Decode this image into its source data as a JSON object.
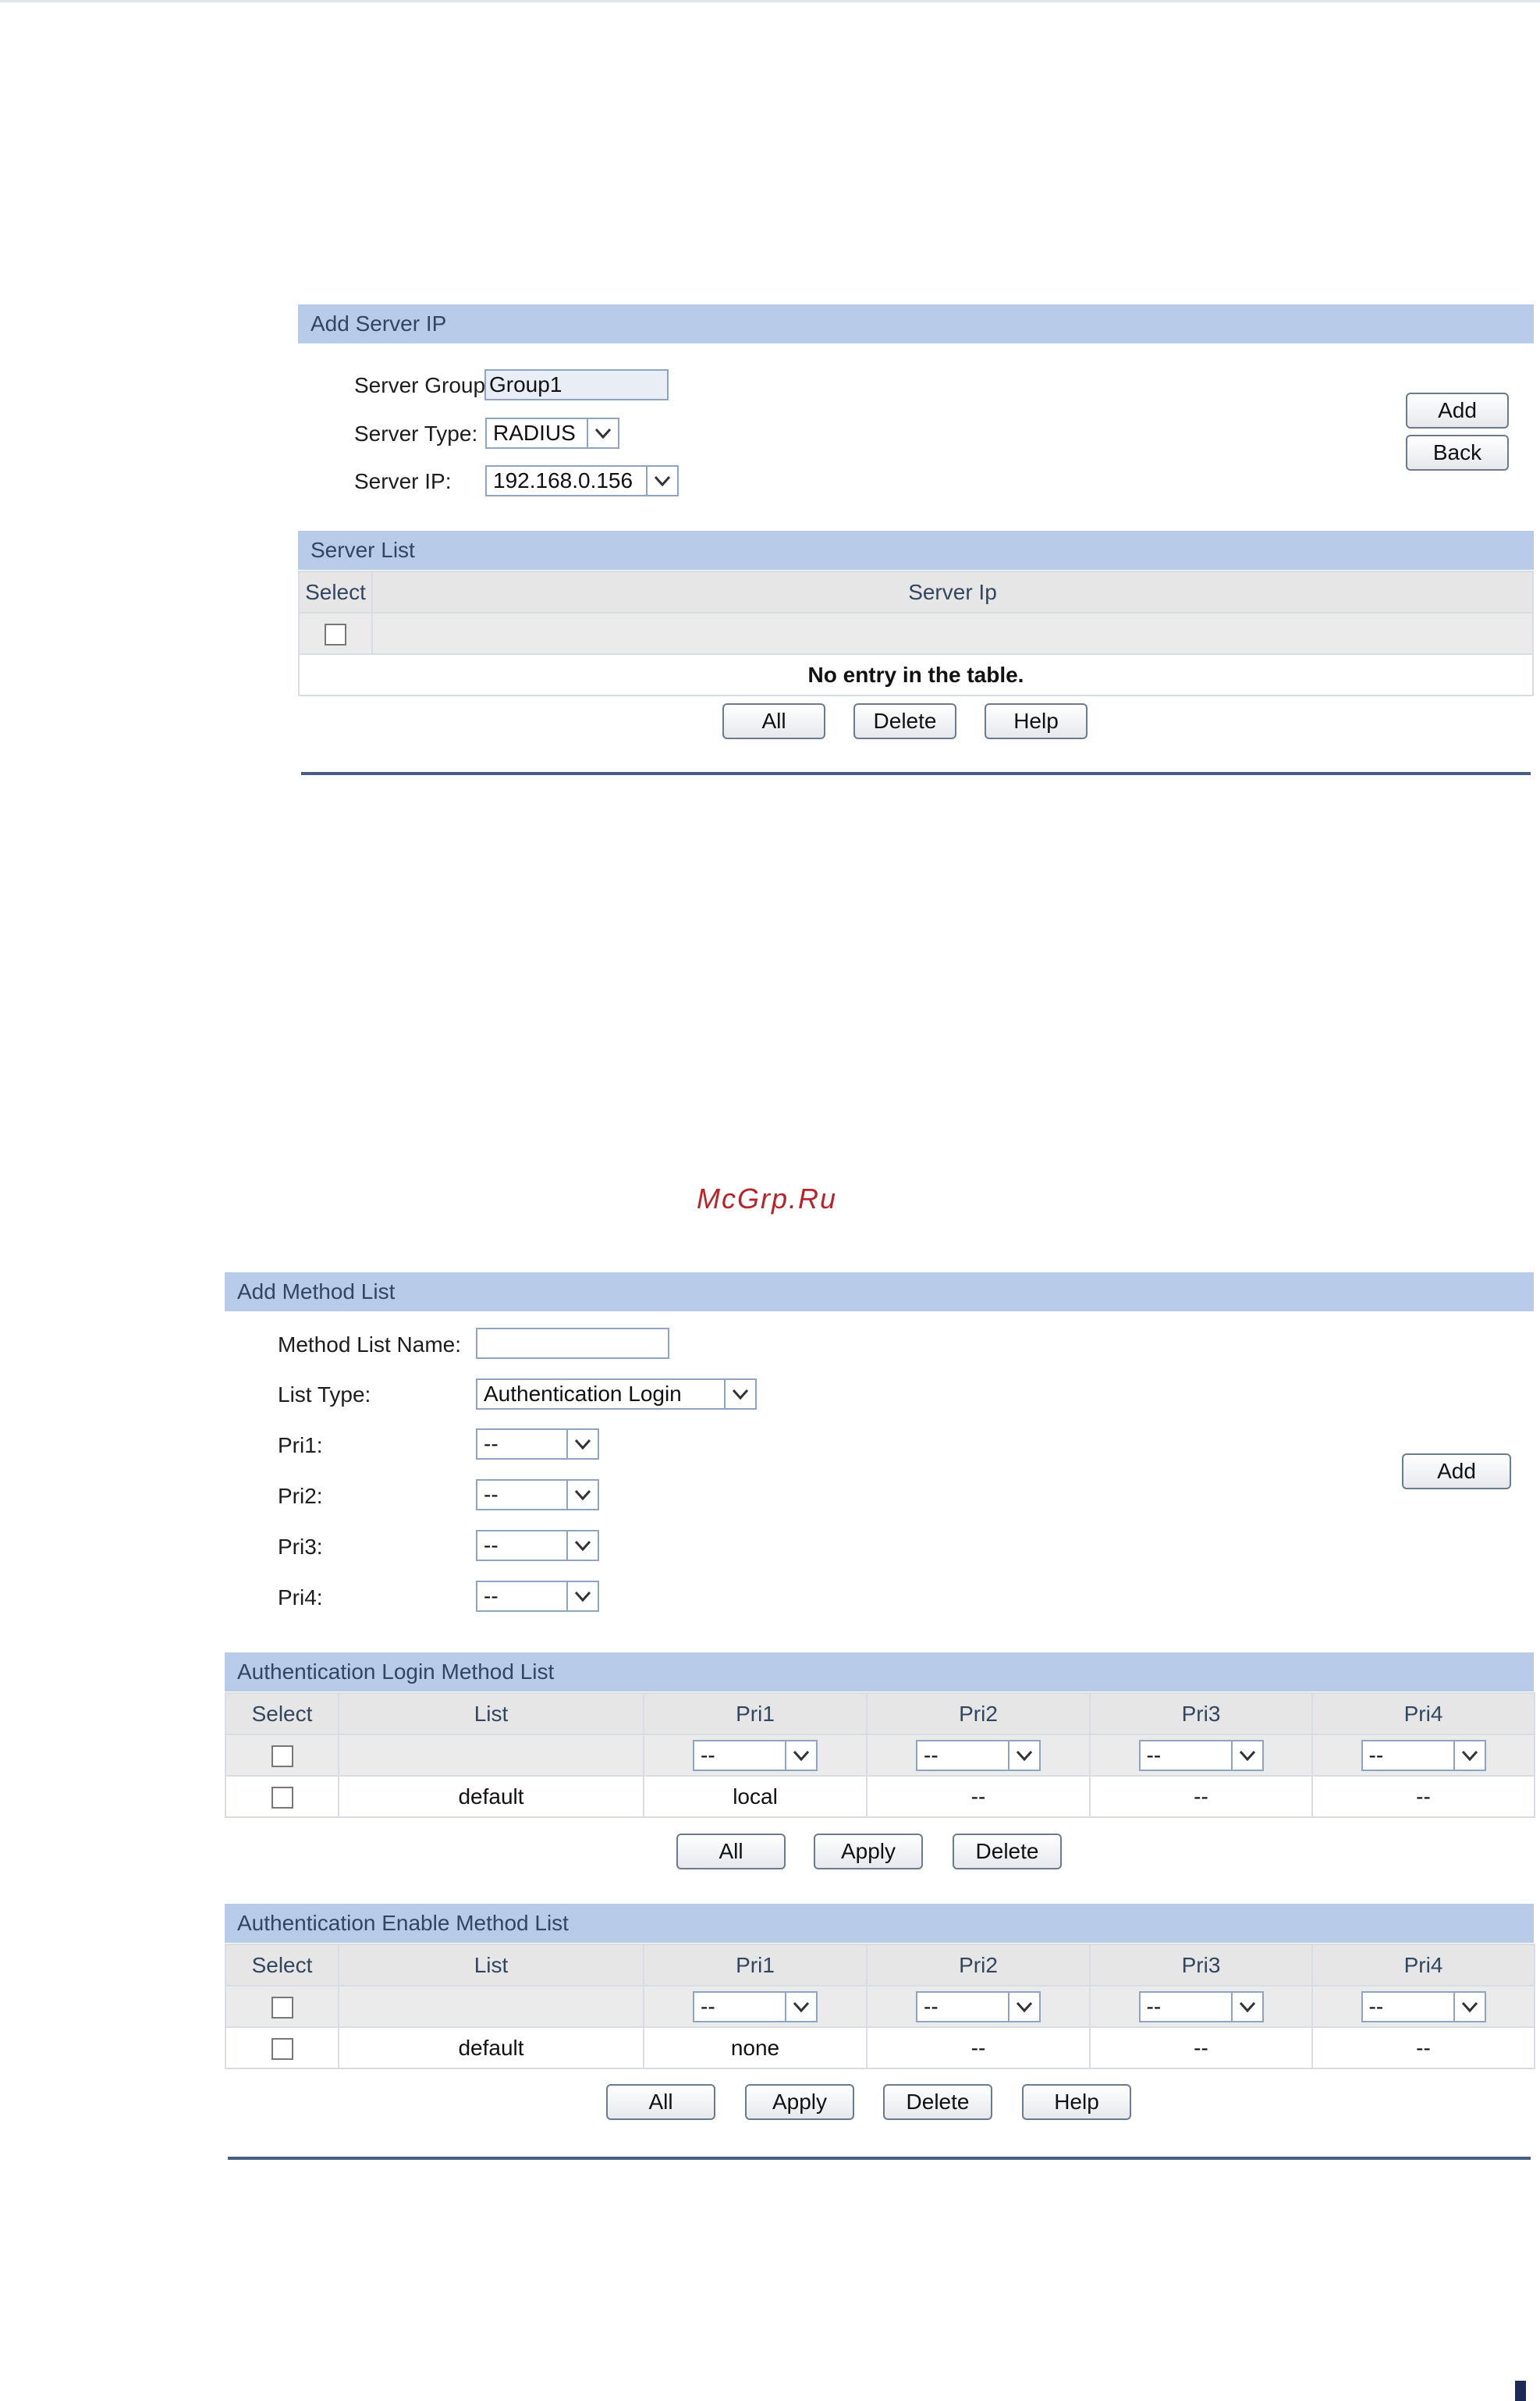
{
  "add_server_ip": {
    "title": "Add Server IP",
    "server_group_label": "Server Group",
    "server_group_value": "Group1",
    "server_type_label": "Server Type:",
    "server_type_value": "RADIUS",
    "server_ip_label": "Server IP:",
    "server_ip_value": "192.168.0.156",
    "add_button": "Add",
    "back_button": "Back"
  },
  "server_list": {
    "title": "Server List",
    "col_select": "Select",
    "col_server_ip": "Server Ip",
    "empty_message": "No entry in the table.",
    "all_button": "All",
    "delete_button": "Delete",
    "help_button": "Help"
  },
  "watermark": "McGrp.Ru",
  "add_method_list": {
    "title": "Add Method List",
    "name_label": "Method List Name:",
    "name_value": "",
    "list_type_label": "List Type:",
    "list_type_value": "Authentication Login",
    "pri1_label": "Pri1:",
    "pri1_value": "--",
    "pri2_label": "Pri2:",
    "pri2_value": "--",
    "pri3_label": "Pri3:",
    "pri3_value": "--",
    "pri4_label": "Pri4:",
    "pri4_value": "--",
    "add_button": "Add"
  },
  "login_method_list": {
    "title": "Authentication Login Method List",
    "columns": [
      "Select",
      "List",
      "Pri1",
      "Pri2",
      "Pri3",
      "Pri4"
    ],
    "filter_values": [
      "--",
      "--",
      "--",
      "--"
    ],
    "rows": [
      {
        "list": "default",
        "pri1": "local",
        "pri2": "--",
        "pri3": "--",
        "pri4": "--"
      }
    ],
    "all_button": "All",
    "apply_button": "Apply",
    "delete_button": "Delete"
  },
  "enable_method_list": {
    "title": "Authentication Enable Method List",
    "columns": [
      "Select",
      "List",
      "Pri1",
      "Pri2",
      "Pri3",
      "Pri4"
    ],
    "filter_values": [
      "--",
      "--",
      "--",
      "--"
    ],
    "rows": [
      {
        "list": "default",
        "pri1": "none",
        "pri2": "--",
        "pri3": "--",
        "pri4": "--"
      }
    ],
    "all_button": "All",
    "apply_button": "Apply",
    "delete_button": "Delete",
    "help_button": "Help"
  }
}
